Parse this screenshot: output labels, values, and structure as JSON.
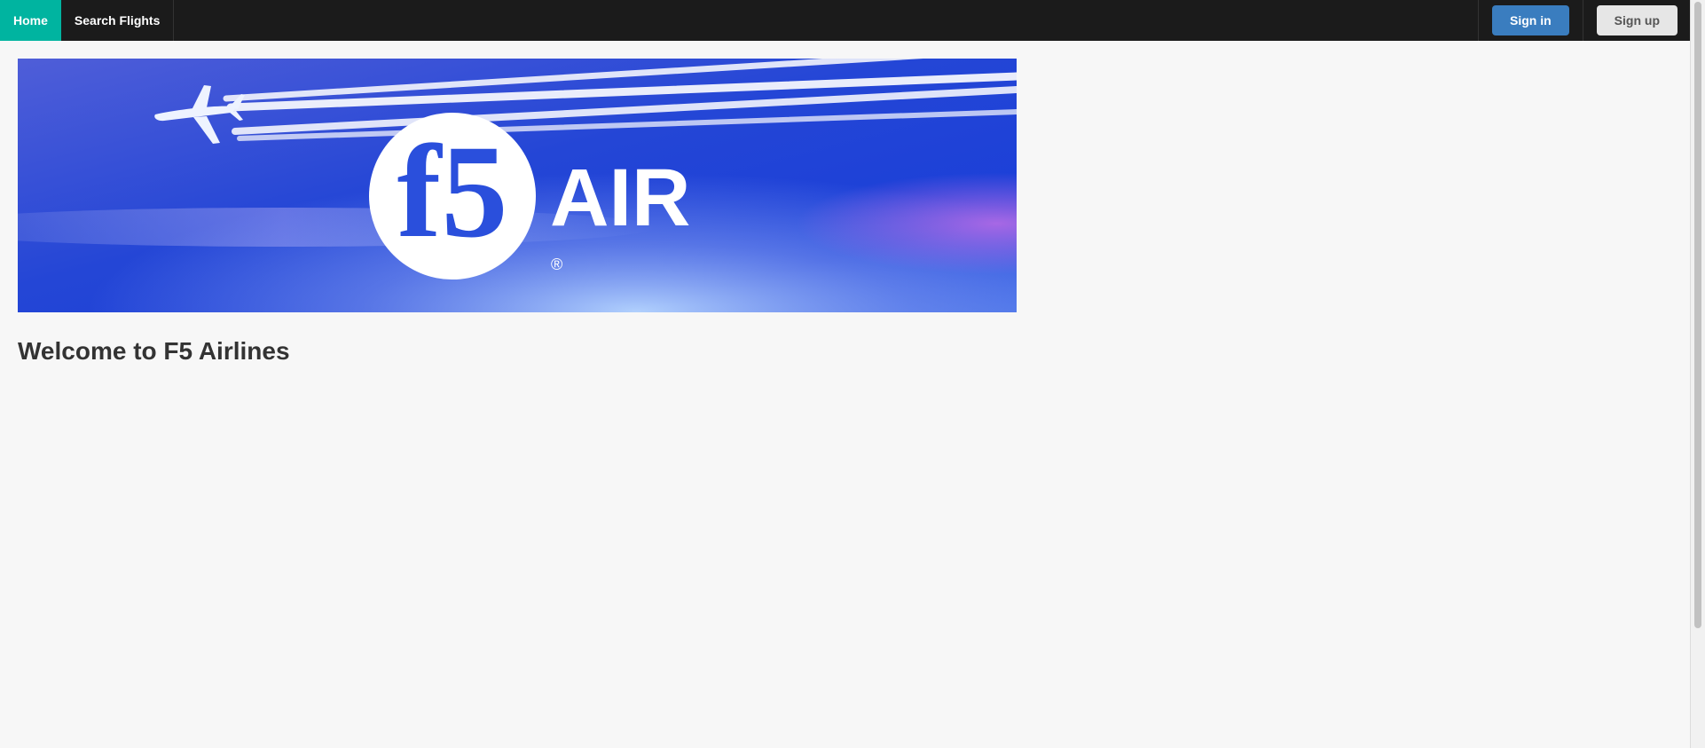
{
  "nav": {
    "items": [
      {
        "label": "Home",
        "active": true
      },
      {
        "label": "Search Flights",
        "active": false
      }
    ],
    "signin_label": "Sign in",
    "signup_label": "Sign up"
  },
  "banner": {
    "logo_letters": "f5",
    "logo_word": "AIR",
    "registered_mark": "®"
  },
  "main": {
    "heading": "Welcome to F5 Airlines"
  },
  "colors": {
    "navbar_bg": "#1b1b1b",
    "nav_active": "#00b4a0",
    "signin_bg": "#3a7dbf",
    "signup_bg": "#e6e6e6",
    "page_bg": "#f7f7f7"
  }
}
